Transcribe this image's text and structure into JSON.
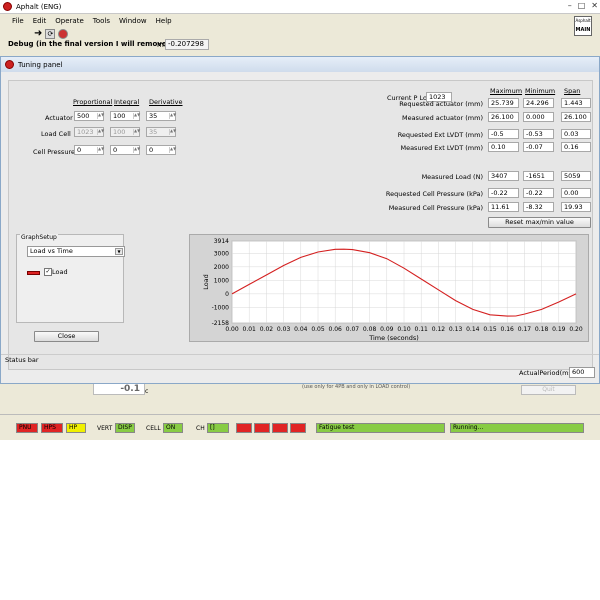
{
  "main_window": {
    "title": "Aphalt (ENG)",
    "menu": [
      "File",
      "Edit",
      "Operate",
      "Tools",
      "Window",
      "Help"
    ],
    "debug_label": "Debug (in the final version I will remove it)",
    "m_label": "m:",
    "m_value": "-0.207298",
    "logo_text": "Asphalt",
    "main_badge": "MAIN"
  },
  "tuning_panel": {
    "title": "Tuning panel",
    "columns": {
      "proportional": "Proportional",
      "integral": "Integral",
      "derivative": "Derivative"
    },
    "rows": [
      {
        "label": "Actuator",
        "proportional": "500",
        "integral": "100",
        "derivative": "35",
        "disabled": false
      },
      {
        "label": "Load Cell",
        "proportional": "1023",
        "integral": "100",
        "derivative": "35",
        "disabled": true
      },
      {
        "label": "Cell Pressure",
        "proportional": "0",
        "integral": "0",
        "derivative": "0",
        "disabled": false
      }
    ],
    "current_p_load_label": "Current P Load",
    "current_p_load_value": "1023",
    "stats_headers": {
      "maximum": "Maximum",
      "minimum": "Minimum",
      "span": "Span"
    },
    "stats": [
      {
        "label": "Requested actuator (mm)",
        "max": "25.739",
        "min": "24.296",
        "span": "1.443"
      },
      {
        "label": "Measured actuator (mm)",
        "max": "26.100",
        "min": "0.000",
        "span": "26.100"
      },
      {
        "label": "Requested Ext LVDT (mm)",
        "max": "-0.5",
        "min": "-0.53",
        "span": "0.03"
      },
      {
        "label": "Measured Ext LVDT (mm)",
        "max": "0.10",
        "min": "-0.07",
        "span": "0.16"
      },
      {
        "label": "Measured Load (N)",
        "max": "3407",
        "min": "-1651",
        "span": "5059"
      },
      {
        "label": "Requested Cell Pressure (kPa)",
        "max": "-0.22",
        "min": "-0.22",
        "span": "0.00"
      },
      {
        "label": "Measured Cell Pressure (kPa)",
        "max": "11.61",
        "min": "-8.32",
        "span": "19.93"
      }
    ],
    "reset_button": "Reset max/min value",
    "graph_setup_title": "GraphSetup",
    "graph_select": "Load vs Time",
    "legend_check": "✓",
    "legend_label": "Load",
    "close_button": "Close",
    "status_bar": "Status bar",
    "actual_period_label": "ActualPeriod(ms):",
    "actual_period_value": "600"
  },
  "chart_data": {
    "type": "line",
    "xlabel": "Time (seconds)",
    "ylabel": "Load",
    "xlim": [
      0,
      0.2
    ],
    "ylim": [
      -2158,
      3914
    ],
    "x_ticks": [
      "0.00",
      "0.01",
      "0.02",
      "0.03",
      "0.04",
      "0.05",
      "0.06",
      "0.07",
      "0.08",
      "0.09",
      "0.10",
      "0.11",
      "0.12",
      "0.13",
      "0.14",
      "0.15",
      "0.16",
      "0.17",
      "0.18",
      "0.19",
      "0.20"
    ],
    "y_ticks": [
      "3914",
      "3000",
      "2000",
      "1000",
      "0",
      "-1000",
      "-2158"
    ],
    "y_tick_values": [
      3914,
      3000,
      2000,
      1000,
      0,
      -1000,
      -2158
    ],
    "grid": true,
    "series": [
      {
        "name": "Load",
        "color": "#d42020",
        "x": [
          0,
          0.01,
          0.02,
          0.03,
          0.04,
          0.05,
          0.06,
          0.065,
          0.07,
          0.08,
          0.09,
          0.1,
          0.11,
          0.12,
          0.13,
          0.14,
          0.15,
          0.16,
          0.165,
          0.17,
          0.18,
          0.19,
          0.2
        ],
        "y": [
          0,
          700,
          1400,
          2100,
          2700,
          3100,
          3300,
          3310,
          3280,
          3050,
          2600,
          1900,
          1100,
          300,
          -500,
          -1150,
          -1550,
          -1650,
          -1640,
          -1500,
          -1150,
          -600,
          0
        ]
      }
    ]
  },
  "behind": {
    "value": "-0.1",
    "unit": "c",
    "note": "(use only for 4PB and only in LOAD control)",
    "quit_button": "Quit"
  },
  "bottom_bar": {
    "pnu": "PNU",
    "hps": "HPS",
    "hp": "HP",
    "vert_label": "VERT",
    "disp": "DISP",
    "cell_label": "CELL",
    "on": "ON",
    "ch_label": "CH",
    "ch_value": "[]",
    "fatigue": "Fatigue test",
    "running": "Running..."
  }
}
